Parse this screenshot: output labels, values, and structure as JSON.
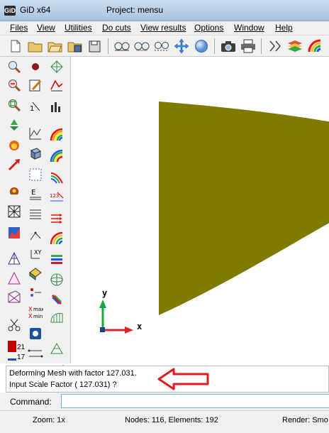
{
  "window": {
    "app_title": "GiD x64",
    "project_title": "Project: mensu",
    "app_icon_text": "GiD"
  },
  "menu": [
    "Files",
    "View",
    "Utilities",
    "Do cuts",
    "View results",
    "Options",
    "Window",
    "Help"
  ],
  "toolbar_top": [
    "new-file-icon",
    "open-folder-icon",
    "open-file-icon",
    "save-icon",
    "save-as-icon",
    "zoom-in-icon",
    "zoom-out-icon",
    "zoom-frame-icon",
    "move-icon",
    "sphere-icon",
    "camera-icon",
    "print-icon",
    "layers-icon",
    "view-layers-icon",
    "color-palette-icon"
  ],
  "toolbar_left": [
    "zoom-icon",
    "dot-icon",
    "mesh-icon",
    "zoom-out-icon",
    "edit-icon",
    "graph-icon",
    "zoom-frame-icon",
    "bar-chart-icon",
    "text-icon",
    "recycle-icon",
    "line-graph-icon",
    "rainbow-icon",
    "fire-icon",
    "cube-icon",
    "rainbow-icon",
    "arrow-icon",
    "select-icon",
    "rainbow-icon",
    "cube-icon",
    "list-icon",
    "vector-icon",
    "mesh-icon",
    "lines-icon",
    "arrows-icon",
    "chart-icon",
    "xyz-icon",
    "rainbow-icon",
    "triangle-icon",
    "frame-icon",
    "bars-icon",
    "triangle-icon",
    "dots-icon",
    "sphere-icon",
    "scissors-icon",
    "max-min-icon",
    "surface-icon",
    "color-bar-icon",
    "info-icon",
    "mesh-icon",
    "legend-icon",
    "lines-icon",
    "lines-icon"
  ],
  "viewport": {
    "axis_y_label": "y",
    "axis_x_label": "x",
    "mesh_color": "#7f7a00"
  },
  "messages": {
    "line1": "Deforming Mesh with factor 127.031.",
    "line2": "Input Scale Factor ( 127.031) ?"
  },
  "command": {
    "label": "Command:",
    "value": ""
  },
  "status": {
    "zoom": "Zoom: 1x",
    "nodes_elements": "Nodes: 116, Elements: 192",
    "render": "Render: Smo"
  },
  "colors": {
    "annotation_arrow": "#e0191f",
    "color_bar_top": "#c00000",
    "color_bar_bottom": "#1a4bd0"
  },
  "colorbar_labels": [
    "21",
    "17"
  ]
}
